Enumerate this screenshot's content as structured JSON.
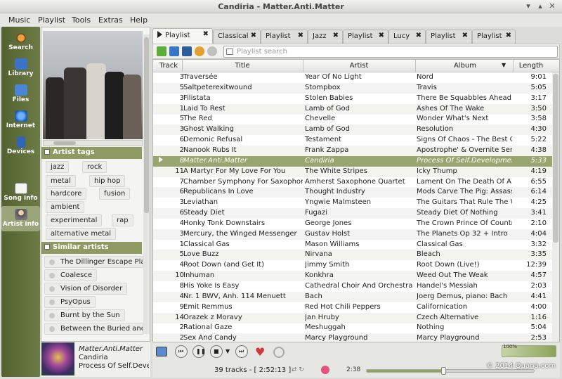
{
  "window": {
    "title": "Candiria - Matter.Anti.Matter"
  },
  "menu": [
    "Music",
    "Playlist",
    "Tools",
    "Extras",
    "Help"
  ],
  "nav": [
    {
      "label": "Search",
      "icon": "search-icon"
    },
    {
      "label": "Library",
      "icon": "library-icon"
    },
    {
      "label": "Files",
      "icon": "files-icon"
    },
    {
      "label": "Internet",
      "icon": "internet-icon"
    },
    {
      "label": "Devices",
      "icon": "devices-icon"
    },
    {
      "label": "Song info",
      "icon": "song-info-icon"
    },
    {
      "label": "Artist info",
      "icon": "artist-info-icon"
    }
  ],
  "artist_tags": {
    "heading": "Artist tags",
    "tags": [
      "jazz",
      "rock",
      "metal",
      "hip hop",
      "hardcore",
      "fusion",
      "ambient",
      "experimental",
      "rap",
      "alternative metal"
    ]
  },
  "similar_artists": {
    "heading": "Similar artists",
    "items": [
      "The Dillinger Escape Plan",
      "Coalesce",
      "Vision of Disorder",
      "PsyOpus",
      "Burnt by the Sun",
      "Between the Buried and Me"
    ]
  },
  "now_playing": {
    "title": "Matter.Anti.Matter",
    "artist": "Candiria",
    "album": "Process Of Self.Development"
  },
  "tabs": [
    "Playlist",
    "Classical",
    "Playlist",
    "Jazz",
    "Playlist",
    "Lucy",
    "Playlist",
    "Playlist"
  ],
  "search": {
    "placeholder": "Playlist search"
  },
  "columns": {
    "track": "Track",
    "title": "Title",
    "artist": "Artist",
    "album": "Album",
    "length": "Length"
  },
  "rows": [
    [
      "3",
      "Traversée",
      "Year Of No Light",
      "Nord",
      "9:01"
    ],
    [
      "5",
      "Saltpeterexitwound",
      "Stompbox",
      "Travis",
      "5:05"
    ],
    [
      "3",
      "Filistata",
      "Stolen Babies",
      "There Be Squabbles Ahead",
      "3:17"
    ],
    [
      "1",
      "Laid To Rest",
      "Lamb of God",
      "Ashes Of The Wake",
      "3:50"
    ],
    [
      "5",
      "The Red",
      "Chevelle",
      "Wonder What's Next",
      "3:58"
    ],
    [
      "3",
      "Ghost Walking",
      "Lamb of God",
      "Resolution",
      "4:30"
    ],
    [
      "6",
      "Demonic Refusal",
      "Testament",
      "Signs Of Chaos - The Best Of Testament",
      "5:22"
    ],
    [
      "2",
      "Nanook Rubs It",
      "Frank Zappa",
      "Apostrophe' & Overnite Sensation",
      "4:38"
    ],
    [
      "8",
      "Matter.Anti.Matter",
      "Candiria",
      "Process Of Self.Development",
      "5:33"
    ],
    [
      "11",
      "A Martyr For My Love For You",
      "The White Stripes",
      "Icky Thump",
      "4:19"
    ],
    [
      "7",
      "Chamber Symphony For Saxophone",
      "Amherst Saxophone Quartet",
      "Lament On The Death Of A Master",
      "6:55"
    ],
    [
      "6",
      "Republicans In Love",
      "Thought Industry",
      "Mods Carve The Pig: Assassins",
      "6:14"
    ],
    [
      "3",
      "Leviathan",
      "Yngwie Malmsteen",
      "The Guitars That Rule The World",
      "4:25"
    ],
    [
      "6",
      "Steady Diet",
      "Fugazi",
      "Steady Diet Of Nothing",
      "3:41"
    ],
    [
      "4",
      "Honky Tonk Downstairs",
      "George Jones",
      "The Crown Prince Of Country",
      "2:10"
    ],
    [
      "3",
      "Mercury, the Winged Messenger",
      "Gustav Holst",
      "The Planets Op 32 + Intro",
      "4:04"
    ],
    [
      "1",
      "Classical Gas",
      "Mason Williams",
      "Classical Gas",
      "3:32"
    ],
    [
      "5",
      "Love Buzz",
      "Nirvana",
      "Bleach",
      "3:35"
    ],
    [
      "4",
      "Root Down (and Get It)",
      "Jimmy Smith",
      "Root Down (Live!)",
      "12:39"
    ],
    [
      "10",
      "Inhuman",
      "Konkhra",
      "Weed Out The Weak",
      "4:57"
    ],
    [
      "8",
      "His Yoke Is Easy",
      "Cathedral Choir And Orchestra",
      "Handel's Messiah",
      "2:03"
    ],
    [
      "4",
      "Nr. 1 BWV, Anh. 114 Menuett",
      "Bach",
      "Joerg Demus, piano: Bach",
      "4:41"
    ],
    [
      "9",
      "Emit Remmus",
      "Red Hot Chili Peppers",
      "Californication",
      "4:00"
    ],
    [
      "14",
      "Orazek z Moravy",
      "Jan Hruby",
      "Czech Alternative",
      "1:16"
    ],
    [
      "2",
      "Rational Gaze",
      "Meshuggah",
      "Nothing",
      "5:04"
    ],
    [
      "2",
      "Sex And Candy",
      "Marcy Playground",
      "Marcy Playground",
      "2:53"
    ]
  ],
  "playing_index": 8,
  "status": {
    "tracks": "39 tracks - [ 2:52:13 ]",
    "elapsed": "2:38",
    "volume": "100%",
    "seek_fraction": 0.46
  },
  "copyright": "© 2014 Quana.com",
  "colors": {
    "accent": "#8d9a62",
    "nav": "#5b6a3a",
    "playing_row": "#98a56e"
  }
}
